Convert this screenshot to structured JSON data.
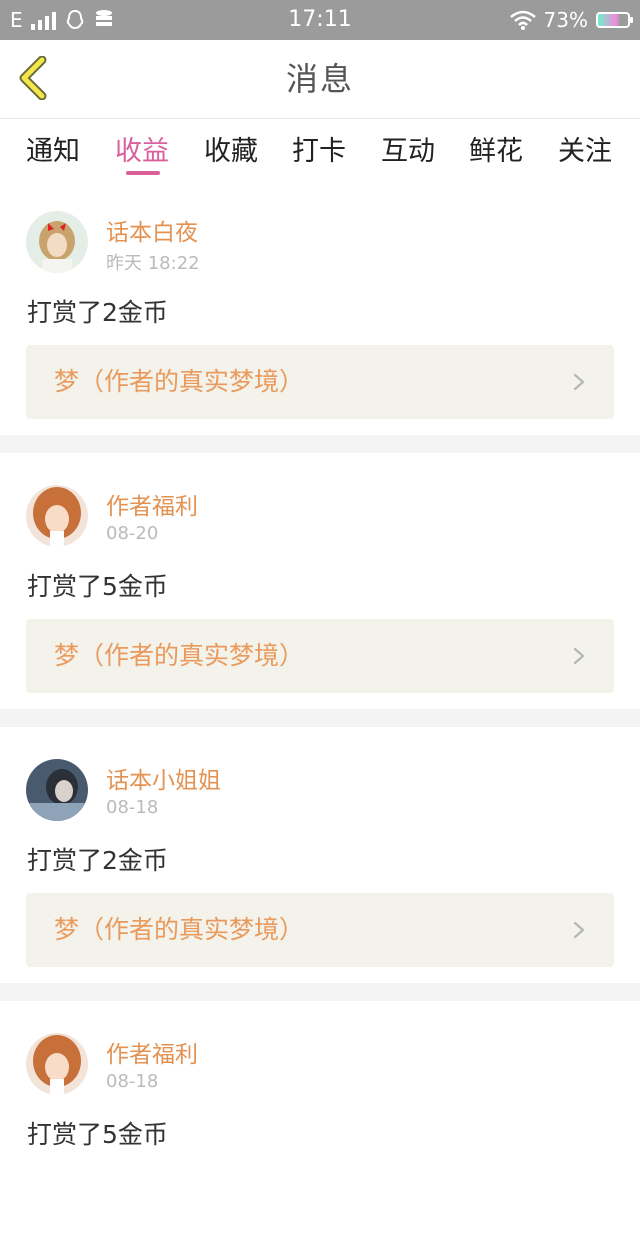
{
  "status_bar": {
    "network": "E",
    "time": "17:11",
    "battery": "73%"
  },
  "header": {
    "title": "消息"
  },
  "tabs": [
    {
      "label": "通知",
      "active": false
    },
    {
      "label": "收益",
      "active": true
    },
    {
      "label": "收藏",
      "active": false
    },
    {
      "label": "打卡",
      "active": false
    },
    {
      "label": "互动",
      "active": false
    },
    {
      "label": "鲜花",
      "active": false
    },
    {
      "label": "关注",
      "active": false
    }
  ],
  "colors": {
    "accent": "#d9609c",
    "username": "#e39252",
    "work_title": "#ea9a5c"
  },
  "messages": [
    {
      "user": "话本白夜",
      "time": "昨天 18:22",
      "action": "打赏了2金币",
      "work": "梦（作者的真实梦境）"
    },
    {
      "user": "作者福利",
      "time": "08-20",
      "action": "打赏了5金币",
      "work": "梦（作者的真实梦境）"
    },
    {
      "user": "话本小姐姐",
      "time": "08-18",
      "action": "打赏了2金币",
      "work": "梦（作者的真实梦境）"
    },
    {
      "user": "作者福利",
      "time": "08-18",
      "action": "打赏了5金币",
      "work": ""
    }
  ]
}
